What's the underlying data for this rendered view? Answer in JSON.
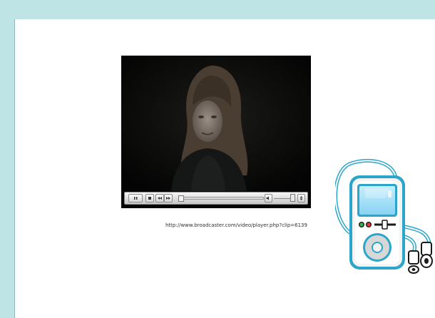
{
  "slide": {
    "frame_color": "#bfe4e6",
    "background_color": "#ffffff"
  },
  "video": {
    "playback_progress": 0.02,
    "volume_level": 0.75,
    "controls": [
      {
        "name": "pause",
        "icon": "pause-icon"
      },
      {
        "name": "stop",
        "icon": "stop-icon"
      },
      {
        "name": "rewind",
        "icon": "rewind-icon"
      },
      {
        "name": "fast_forward",
        "icon": "fast-forward-icon"
      },
      {
        "name": "volume",
        "icon": "speaker-icon"
      },
      {
        "name": "fullscreen",
        "icon": "expand-icon"
      }
    ]
  },
  "caption": {
    "url": "http://www.broadcaster.com/video/player.php?clip=6139"
  },
  "clipart": {
    "icon": "mp3-player-icon",
    "screen_color": "#87d3f3",
    "outline_color": "#2ba6ca"
  }
}
